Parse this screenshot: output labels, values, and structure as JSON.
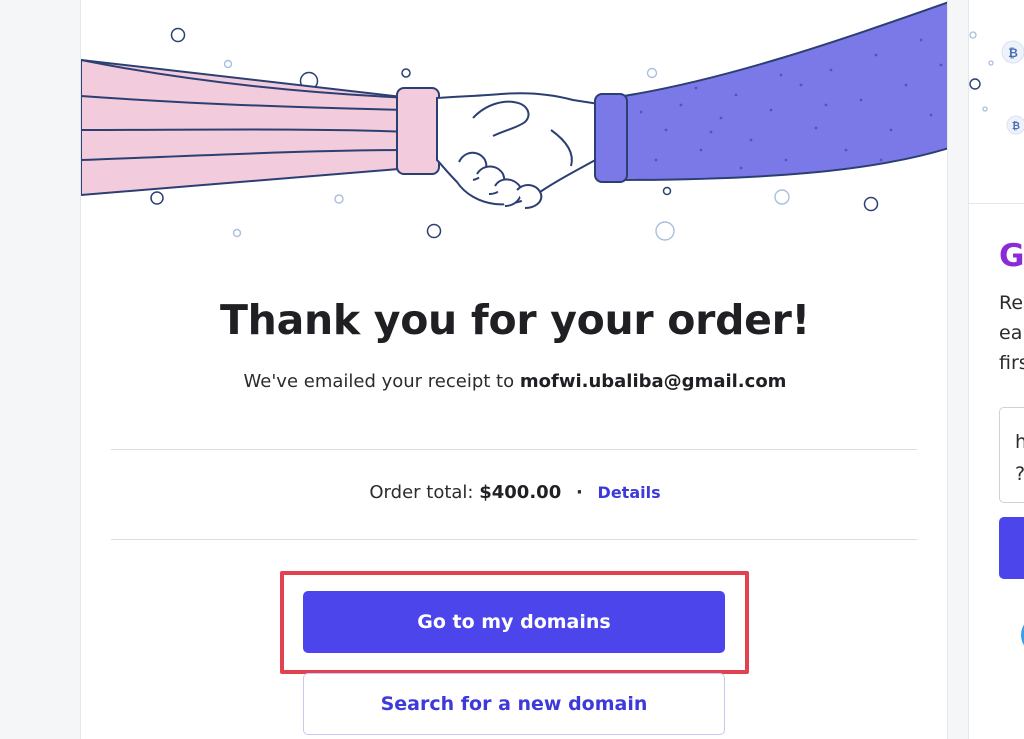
{
  "confirmation": {
    "title": "Thank you for your order!",
    "receipt_prefix": "We've emailed your receipt to",
    "email": "mofwi.ubaliba@gmail.com",
    "order_total_label": "Order total:",
    "order_total_amount": "$400.00",
    "separator": "·",
    "details_link": "Details",
    "primary_button": "Go to my domains",
    "secondary_button": "Search for a new domain"
  },
  "side_panel": {
    "heading": "Gi",
    "text_lines": [
      "Re",
      "ea",
      "firs"
    ],
    "field_lines": [
      "h",
      "?"
    ]
  },
  "colors": {
    "brand_primary": "#4b45eb",
    "link": "#3d3ad9",
    "highlight_border": "#e2424f",
    "left_sleeve": "#f2cbdc",
    "right_sleeve": "#7b79e8",
    "side_heading": "#8a2bd6"
  },
  "icons": {
    "hero": "handshake-illustration",
    "side_coin": "bitcoin-coin-icon"
  }
}
